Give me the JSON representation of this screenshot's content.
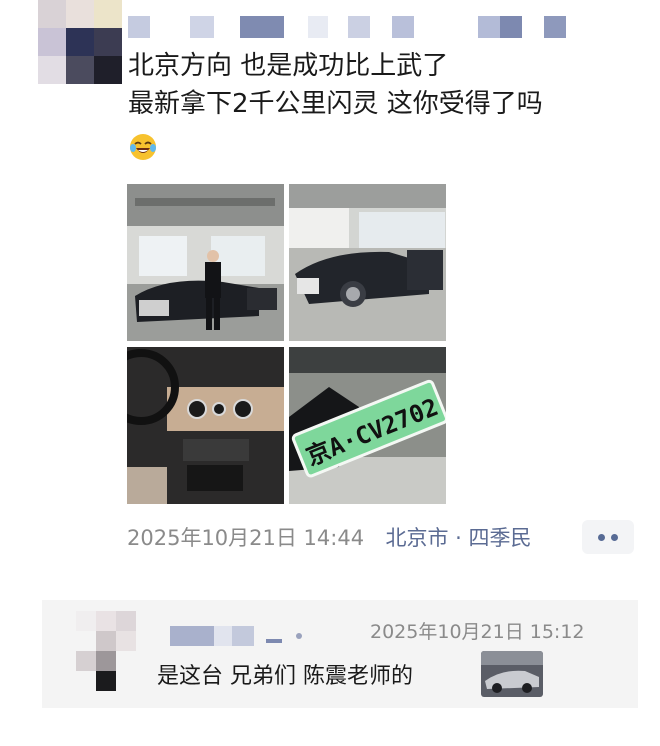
{
  "post": {
    "line1": "北京方向 也是成功比上武了",
    "line2": "最新拿下2千公里闪灵 这你受得了吗",
    "emoji": "laughing-tears-emoji",
    "photos": [
      {
        "desc": "man-standing-beside-damaged-black-car-in-garage"
      },
      {
        "desc": "black-car-with-open-door-in-garage"
      },
      {
        "desc": "car-interior-dashboard"
      },
      {
        "desc": "green-license-plate"
      }
    ],
    "license_plate": "京A·CV2702",
    "time": "2025年10月21日 14:44",
    "location": "北京市 · 四季民",
    "more_button_icon": "more-dots-icon"
  },
  "comment": {
    "time": "2025年10月21日 15:12",
    "text": "是这台 兄弟们 陈震老师的",
    "thumbnail": "car-thumbnail"
  },
  "colors": {
    "link": "#576b95",
    "meta": "#8a8a8a",
    "comment_bg": "#f4f4f4"
  }
}
